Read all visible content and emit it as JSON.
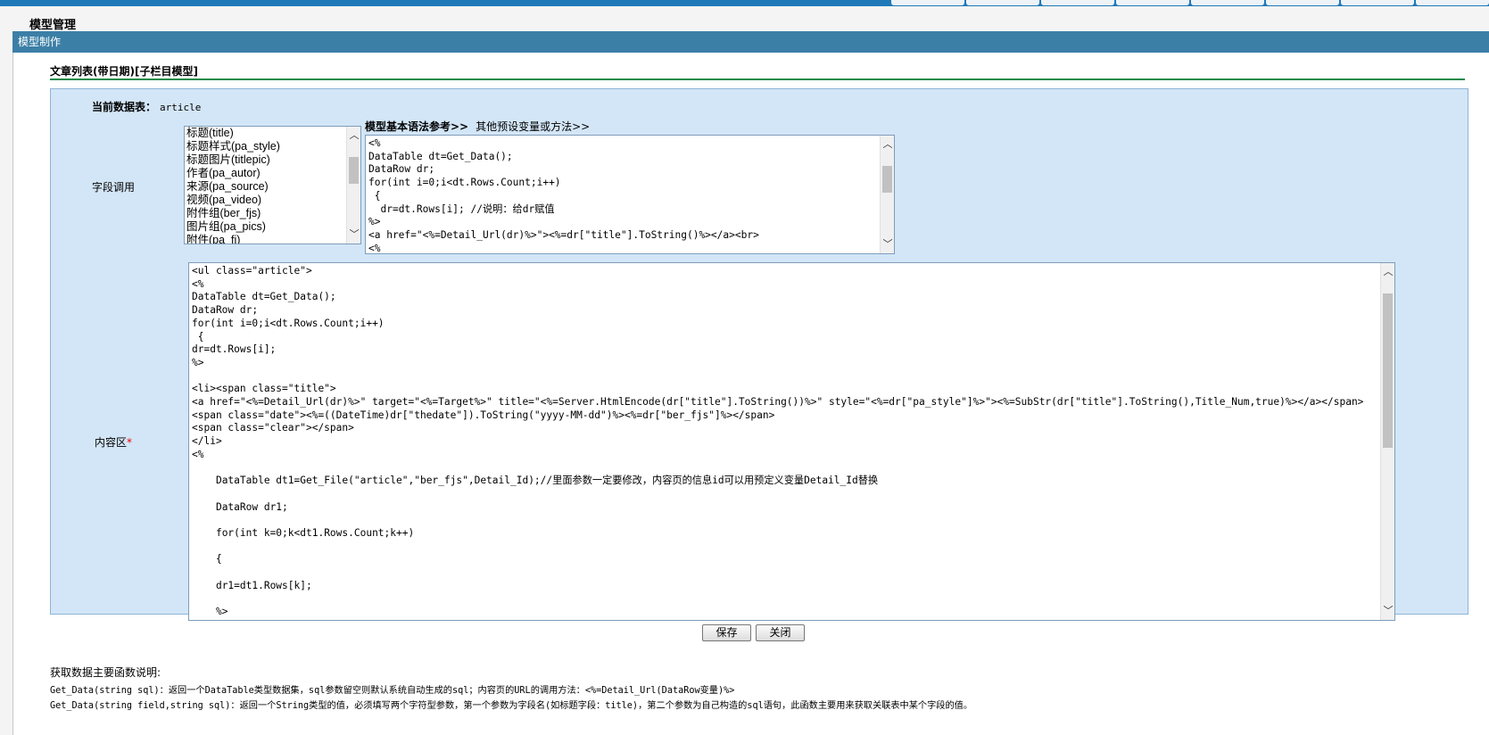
{
  "page": {
    "title": "模型管理",
    "section": "模型制作",
    "model_title": "文章列表(带日期)[子栏目模型]"
  },
  "form": {
    "current_table_label": "当前数据表：",
    "current_table_value": "article",
    "field_call_label": "字段调用",
    "content_label": "内容区",
    "required_mark": "*",
    "syntax_ref_label": "模型基本语法参考>>",
    "other_vars_label": "其他预设变量或方法>>"
  },
  "fields": [
    "标题(title)",
    "标题样式(pa_style)",
    "标题图片(titlepic)",
    "作者(pa_autor)",
    "来源(pa_source)",
    "视频(pa_video)",
    "附件组(ber_fjs)",
    "图片组(pa_pics)",
    "附件(pa_fj)"
  ],
  "syntax_code": "<%\nDataTable dt=Get_Data();\nDataRow dr;\nfor(int i=0;i<dt.Rows.Count;i++)\n {\n  dr=dt.Rows[i]; //说明：给dr赋值\n%>\n<a href=\"<%=Detail_Url(dr)%>\"><%=dr[\"title\"].ToString()%></a><br>\n<%",
  "content_code": "<ul class=\"article\">\n<%\nDataTable dt=Get_Data();\nDataRow dr;\nfor(int i=0;i<dt.Rows.Count;i++)\n {\ndr=dt.Rows[i];\n%>\n\n<li><span class=\"title\">\n<a href=\"<%=Detail_Url(dr)%>\" target=\"<%=Target%>\" title=\"<%=Server.HtmlEncode(dr[\"title\"].ToString())%>\" style=\"<%=dr[\"pa_style\"]%>\"><%=SubStr(dr[\"title\"].ToString(),Title_Num,true)%></a></span>\n<span class=\"date\"><%=((DateTime)dr[\"thedate\"]).ToString(\"yyyy-MM-dd\")%><%=dr[\"ber_fjs\"]%></span>\n<span class=\"clear\"></span>\n</li>\n<%\n\n    DataTable dt1=Get_File(\"article\",\"ber_fjs\",Detail_Id);//里面参数一定要修改，内容页的信息id可以用预定义变量Detail_Id替换\n\n    DataRow dr1;\n\n    for(int k=0;k<dt1.Rows.Count;k++)\n\n    {\n\n    dr1=dt1.Rows[k];\n\n    %>",
  "buttons": {
    "save": "保存",
    "close": "关闭"
  },
  "notes": {
    "heading": "获取数据主要函数说明:",
    "line1": "Get_Data(string sql)：返回一个DataTable类型数据集，sql参数留空则默认系统自动生成的sql；内容页的URL的调用方法：<%=Detail_Url(DataRow变量)%>",
    "line2": "Get_Data(string field,string sql)：返回一个String类型的值，必须填写两个字符型参数，第一个参数为字段名(如标题字段：title)，第二个参数为自己构造的sql语句，此函数主要用来获取关联表中某个字段的值。"
  }
}
